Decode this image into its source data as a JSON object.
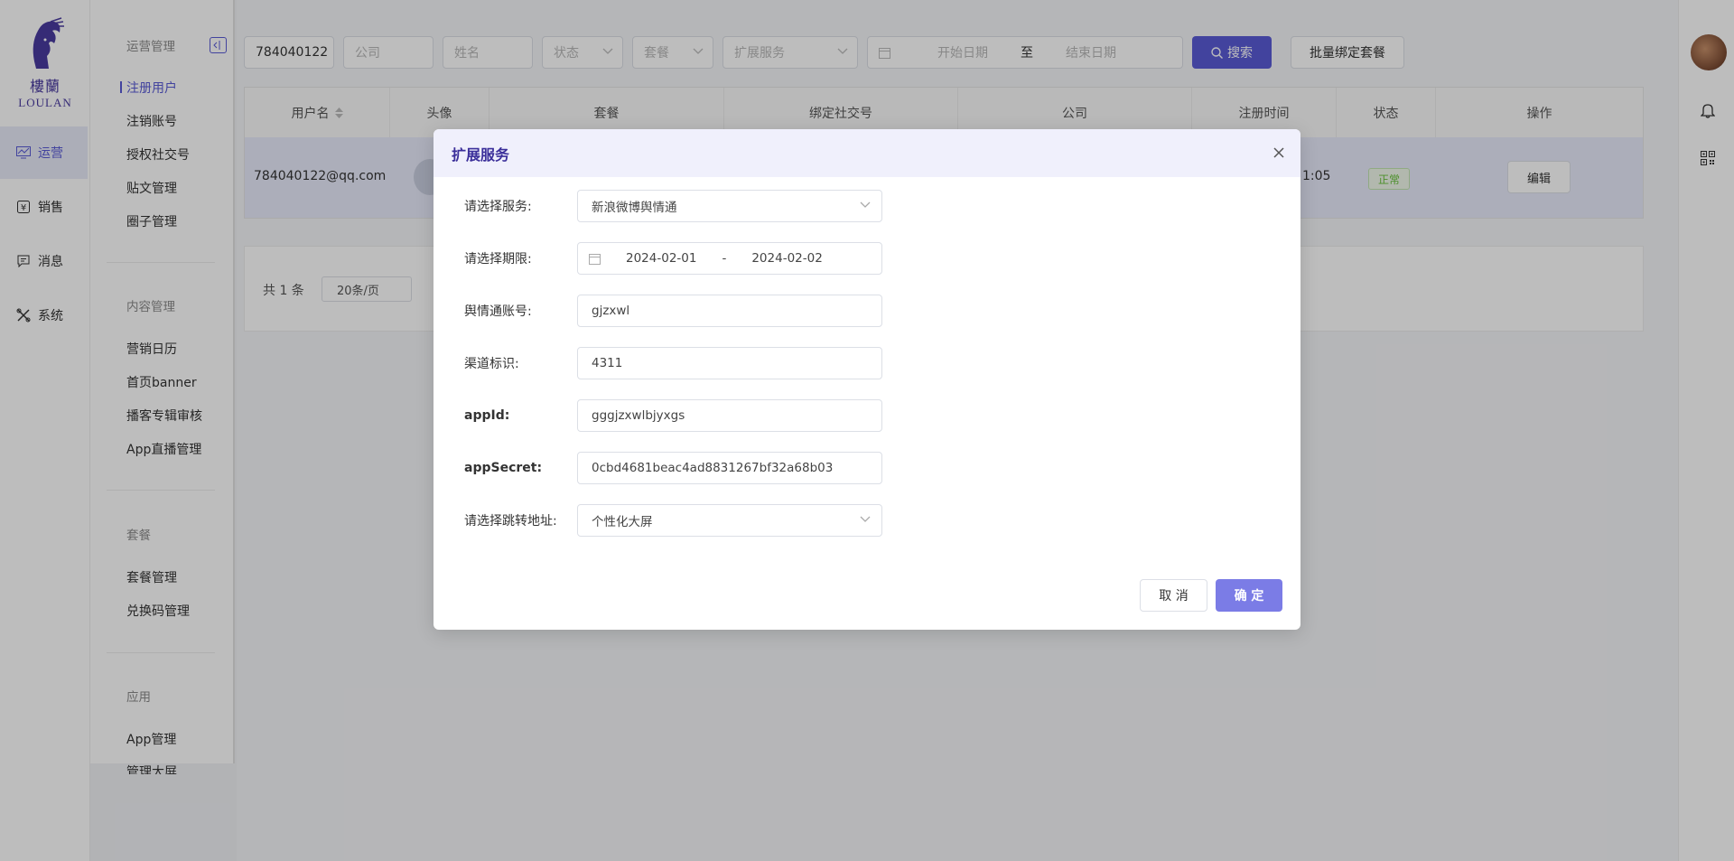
{
  "brand": {
    "cn": "樓蘭",
    "en": "LOULAN"
  },
  "rail": {
    "items": [
      {
        "label": "运营",
        "icon": "chart-icon",
        "active": true
      },
      {
        "label": "销售",
        "icon": "yen-icon"
      },
      {
        "label": "消息",
        "icon": "message-icon"
      },
      {
        "label": "系统",
        "icon": "tools-icon"
      }
    ]
  },
  "submenu": {
    "groups": [
      {
        "title": "运营管理",
        "items": [
          "注册用户",
          "注销账号",
          "授权社交号",
          "贴文管理",
          "圈子管理"
        ]
      },
      {
        "title": "内容管理",
        "items": [
          "营销日历",
          "首页banner",
          "播客专辑审核",
          "App直播管理"
        ]
      },
      {
        "title": "套餐",
        "items": [
          "套餐管理",
          "兑换码管理"
        ]
      },
      {
        "title": "应用",
        "items": [
          "App管理",
          "管理大屏"
        ]
      }
    ],
    "active_item": "注册用户"
  },
  "filters": {
    "keyword_value": "784040122",
    "company_placeholder": "公司",
    "name_placeholder": "姓名",
    "status_placeholder": "状态",
    "package_placeholder": "套餐",
    "ext_service_placeholder": "扩展服务",
    "start_date_placeholder": "开始日期",
    "range_sep": "至",
    "end_date_placeholder": "结束日期",
    "search_label": "搜索",
    "batch_label": "批量绑定套餐"
  },
  "table": {
    "headers": [
      "用户名",
      "头像",
      "套餐",
      "绑定社交号",
      "公司",
      "注册时间",
      "状态",
      "操作"
    ],
    "row": {
      "username": "784040122@qq.com",
      "reg_time_tail": "1:05",
      "status": "正常",
      "action": "编辑"
    }
  },
  "pager": {
    "total": "共 1 条",
    "page_size": "20条/页"
  },
  "modal": {
    "title": "扩展服务",
    "fields": {
      "service": {
        "label": "请选择服务:",
        "value": "新浪微博舆情通"
      },
      "period": {
        "label": "请选择期限:",
        "start": "2024-02-01",
        "sep": "-",
        "end": "2024-02-02"
      },
      "account": {
        "label": "舆情通账号:",
        "value": "gjzxwl"
      },
      "channel": {
        "label": "渠道标识:",
        "value": "4311"
      },
      "appid": {
        "label": "appId:",
        "value": "gggjzxwlbjyxgs"
      },
      "appsecret": {
        "label": "appSecret:",
        "value": "0cbd4681beac4ad8831267bf32a68b03"
      },
      "redirect": {
        "label": "请选择跳转地址:",
        "value": "个性化大屏"
      }
    },
    "cancel_label": "取 消",
    "ok_label": "确 定"
  },
  "colors": {
    "accent": "#5a5bd6",
    "modal_header": "#f0f0fc",
    "ok_button": "#7b7ce6"
  }
}
